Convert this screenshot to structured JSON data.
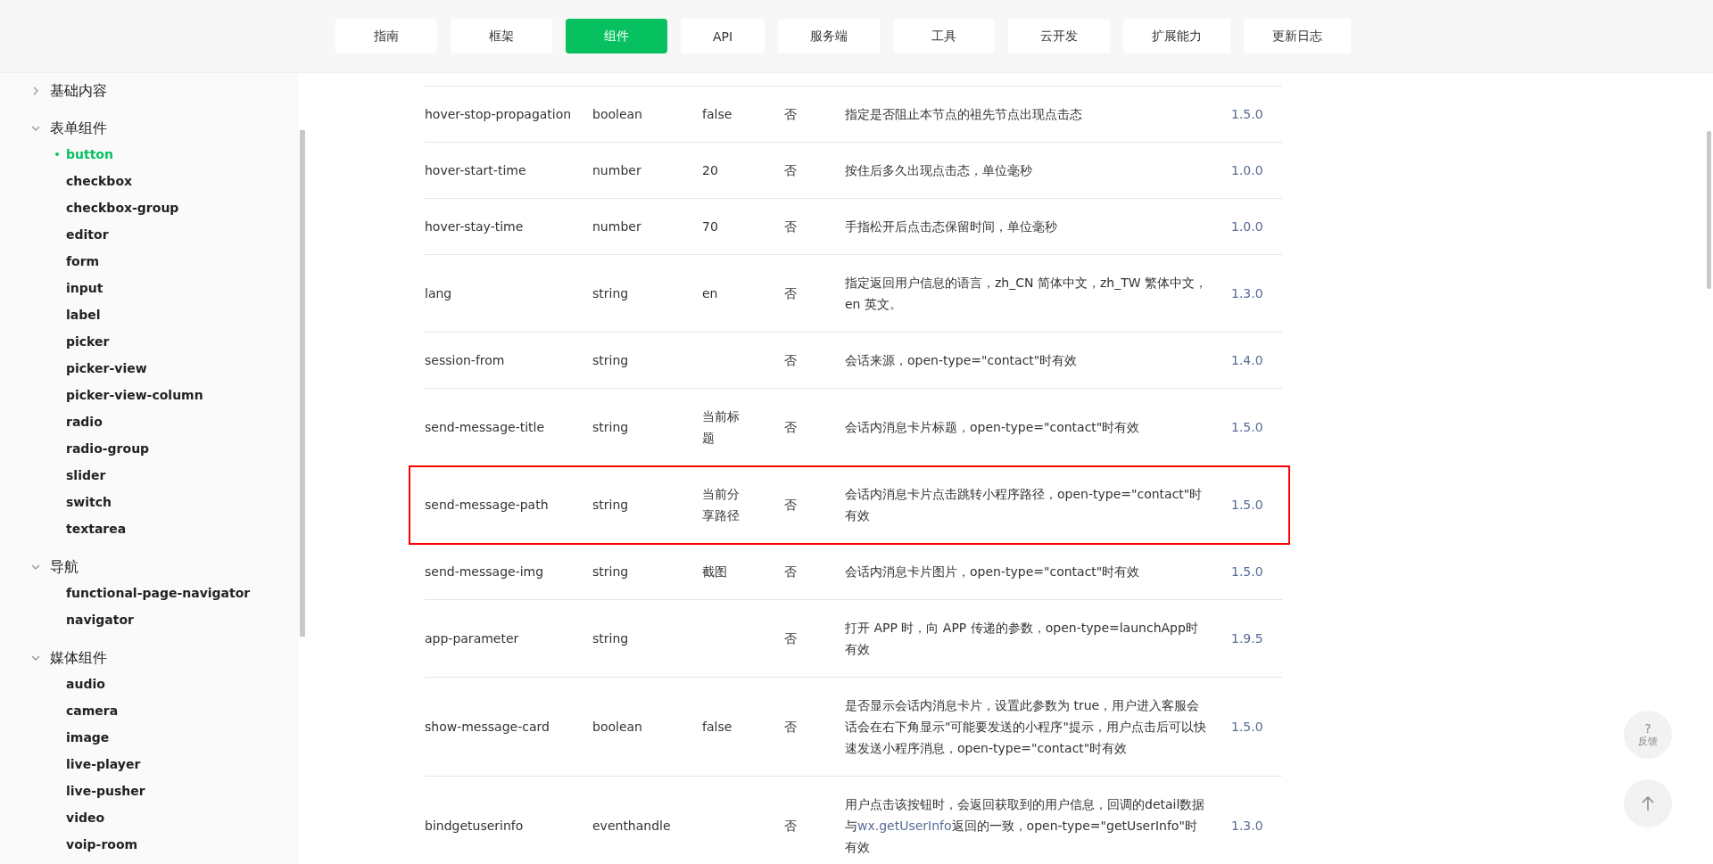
{
  "nav": {
    "tabs": [
      {
        "label": "指南",
        "selected": false
      },
      {
        "label": "框架",
        "selected": false
      },
      {
        "label": "组件",
        "selected": true
      },
      {
        "label": "API",
        "selected": false
      },
      {
        "label": "服务端",
        "selected": false
      },
      {
        "label": "工具",
        "selected": false
      },
      {
        "label": "云开发",
        "selected": false
      },
      {
        "label": "扩展能力",
        "selected": false
      },
      {
        "label": "更新日志",
        "selected": false
      }
    ]
  },
  "sidebar": {
    "groups": [
      {
        "label": "基础内容",
        "expanded": false
      },
      {
        "label": "表单组件",
        "expanded": true,
        "children": [
          {
            "label": "button",
            "selected": true
          },
          {
            "label": "checkbox",
            "selected": false
          },
          {
            "label": "checkbox-group",
            "selected": false
          },
          {
            "label": "editor",
            "selected": false
          },
          {
            "label": "form",
            "selected": false
          },
          {
            "label": "input",
            "selected": false
          },
          {
            "label": "label",
            "selected": false
          },
          {
            "label": "picker",
            "selected": false
          },
          {
            "label": "picker-view",
            "selected": false
          },
          {
            "label": "picker-view-column",
            "selected": false
          },
          {
            "label": "radio",
            "selected": false
          },
          {
            "label": "radio-group",
            "selected": false
          },
          {
            "label": "slider",
            "selected": false
          },
          {
            "label": "switch",
            "selected": false
          },
          {
            "label": "textarea",
            "selected": false
          }
        ]
      },
      {
        "label": "导航",
        "expanded": true,
        "children": [
          {
            "label": "functional-page-navigator",
            "selected": false
          },
          {
            "label": "navigator",
            "selected": false
          }
        ]
      },
      {
        "label": "媒体组件",
        "expanded": true,
        "children": [
          {
            "label": "audio",
            "selected": false
          },
          {
            "label": "camera",
            "selected": false
          },
          {
            "label": "image",
            "selected": false
          },
          {
            "label": "live-player",
            "selected": false
          },
          {
            "label": "live-pusher",
            "selected": false
          },
          {
            "label": "video",
            "selected": false
          },
          {
            "label": "voip-room",
            "selected": false
          }
        ]
      }
    ]
  },
  "table": {
    "rows": [
      {
        "name": "hover-stop-propagation",
        "type": "boolean",
        "default": "false",
        "required": "否",
        "description": "指定是否阻止本节点的祖先节点出现点击态",
        "version": "1.5.0",
        "highlighted": false
      },
      {
        "name": "hover-start-time",
        "type": "number",
        "default": "20",
        "required": "否",
        "description": "按住后多久出现点击态，单位毫秒",
        "version": "1.0.0",
        "highlighted": false
      },
      {
        "name": "hover-stay-time",
        "type": "number",
        "default": "70",
        "required": "否",
        "description": "手指松开后点击态保留时间，单位毫秒",
        "version": "1.0.0",
        "highlighted": false
      },
      {
        "name": "lang",
        "type": "string",
        "default": "en",
        "required": "否",
        "description": "指定返回用户信息的语言，zh_CN 简体中文，zh_TW 繁体中文，en 英文。",
        "version": "1.3.0",
        "highlighted": false
      },
      {
        "name": "session-from",
        "type": "string",
        "default": "",
        "required": "否",
        "description": "会话来源，open-type=\"contact\"时有效",
        "version": "1.4.0",
        "highlighted": false
      },
      {
        "name": "send-message-title",
        "type": "string",
        "default": "当前标题",
        "required": "否",
        "description": "会话内消息卡片标题，open-type=\"contact\"时有效",
        "version": "1.5.0",
        "highlighted": false
      },
      {
        "name": "send-message-path",
        "type": "string",
        "default": "当前分享路径",
        "required": "否",
        "description": "会话内消息卡片点击跳转小程序路径，open-type=\"contact\"时有效",
        "version": "1.5.0",
        "highlighted": true
      },
      {
        "name": "send-message-img",
        "type": "string",
        "default": "截图",
        "required": "否",
        "description": "会话内消息卡片图片，open-type=\"contact\"时有效",
        "version": "1.5.0",
        "highlighted": false
      },
      {
        "name": "app-parameter",
        "type": "string",
        "default": "",
        "required": "否",
        "description": "打开 APP 时，向 APP 传递的参数，open-type=launchApp时有效",
        "version": "1.9.5",
        "highlighted": false
      },
      {
        "name": "show-message-card",
        "type": "boolean",
        "default": "false",
        "required": "否",
        "description": "是否显示会话内消息卡片，设置此参数为 true，用户进入客服会话会在右下角显示\"可能要发送的小程序\"提示，用户点击后可以快速发送小程序消息，open-type=\"contact\"时有效",
        "version": "1.5.0",
        "highlighted": false
      },
      {
        "name": "bindgetuserinfo",
        "type": "eventhandle",
        "default": "",
        "required": "否",
        "description": [
          {
            "text": "用户点击该按钮时，会返回获取到的用户信息，回调的detail数据与"
          },
          {
            "text": "wx.getUserInfo",
            "kind": "link"
          },
          {
            "text": "返回的一致，open-type=\"getUserInfo\"时有效"
          }
        ],
        "version": "1.3.0",
        "highlighted": false
      }
    ]
  },
  "floating": {
    "feedback": {
      "symbol": "?",
      "label": "反馈"
    }
  }
}
